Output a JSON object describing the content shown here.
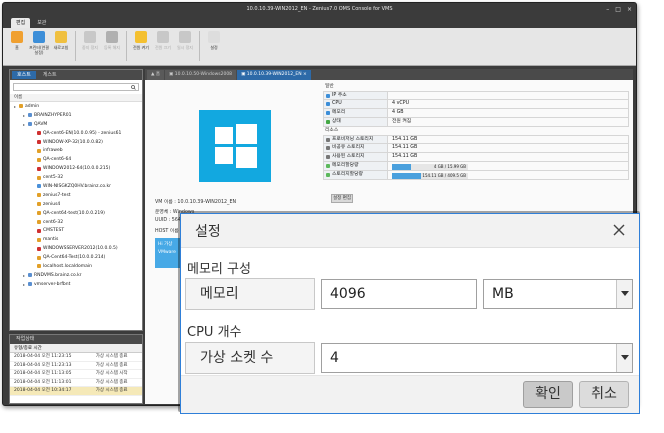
{
  "window": {
    "title": "10.0.10.39-WIN2012_EN - Zenius7.0 OMS Console for VMS",
    "controls": [
      "–",
      "□",
      "×"
    ]
  },
  "menu": {
    "tabs": [
      "편집",
      "보관"
    ]
  },
  "ribbon": {
    "buttons": [
      {
        "label": "홈",
        "icon": "home-icon",
        "color": "#f0a030",
        "disabled": false
      },
      {
        "label": "프린터(연결 설정)",
        "icon": "printer-icon",
        "color": "#3c8ed8",
        "disabled": false
      },
      {
        "label": "새로고침",
        "icon": "refresh-icon",
        "color": "#f0c040",
        "disabled": false
      },
      {
        "label": "중지 정지",
        "icon": "stop-icon",
        "color": "#c8c8c8",
        "disabled": true
      },
      {
        "label": "등록 해지",
        "icon": "register-icon",
        "color": "#b0b0b0",
        "disabled": true
      },
      {
        "label": "전원 켜기",
        "icon": "power-on-icon",
        "color": "#f4c030",
        "disabled": false
      },
      {
        "label": "전원 끄기",
        "icon": "power-off-icon",
        "color": "#c8c8c8",
        "disabled": true
      },
      {
        "label": "일시 정지",
        "icon": "pause-icon",
        "color": "#c8c8c8",
        "disabled": true
      },
      {
        "label": "설정",
        "icon": "settings-icon",
        "color": "#dddddd",
        "disabled": false
      }
    ]
  },
  "left": {
    "tabs": [
      "호스트",
      "게스트"
    ],
    "search_icon": "search-icon",
    "tree_header": "이름",
    "tree": [
      {
        "text": "admin",
        "indent": 0,
        "color": "#e2a028"
      },
      {
        "text": "BRAINZHYPER01",
        "indent": 1,
        "color": "#5a8fd0"
      },
      {
        "text": "QAVM",
        "indent": 1,
        "color": "#5a8fd0"
      },
      {
        "text": "QA-cent6-EN(10.0.0.95) - zenius61",
        "indent": 2,
        "color": "#d03030"
      },
      {
        "text": "WINDOW-XP-32(10.0.0.82)",
        "indent": 2,
        "color": "#d03030"
      },
      {
        "text": "infraweb",
        "indent": 2,
        "color": "#e2a028"
      },
      {
        "text": "QA-cent6-64",
        "indent": 2,
        "color": "#e2a028"
      },
      {
        "text": "WINDOW2012-64(10.0.0.215)",
        "indent": 2,
        "color": "#d03030"
      },
      {
        "text": "cent5-32",
        "indent": 2,
        "color": "#e2a028"
      },
      {
        "text": "WIN-NISGKZQ0HV.brainz.co.kr",
        "indent": 2,
        "color": "#4a90d9"
      },
      {
        "text": "zenius7-test",
        "indent": 2,
        "color": "#e2a028"
      },
      {
        "text": "zenius4",
        "indent": 2,
        "color": "#e2a028"
      },
      {
        "text": "QA-cent64-test(10.0.0.219)",
        "indent": 2,
        "color": "#e2a028"
      },
      {
        "text": "cent6-32",
        "indent": 2,
        "color": "#e2a028"
      },
      {
        "text": "CMSTEST",
        "indent": 2,
        "color": "#d03030"
      },
      {
        "text": "mantis",
        "indent": 2,
        "color": "#e2a028"
      },
      {
        "text": "WINDOWSSERVER2012(10.0.0.5)",
        "indent": 2,
        "color": "#d03030"
      },
      {
        "text": "QA-Cent64-Test(10.0.0.214)",
        "indent": 2,
        "color": "#e2a028"
      },
      {
        "text": "localhost.localdomain",
        "indent": 2,
        "color": "#e2a028"
      },
      {
        "text": "RNDVMS.brainz.co.kr",
        "indent": 1,
        "color": "#5a8fd0"
      },
      {
        "text": "vmserver-brfbnt",
        "indent": 1,
        "color": "#5a8fd0"
      }
    ]
  },
  "log": {
    "tab": "작업상태",
    "columns": [
      "유형/종료 시간",
      ""
    ],
    "rows": [
      {
        "time": "2018-04-04 오전 11:23:15",
        "msg": "가상 시스템 종료"
      },
      {
        "time": "2018-04-04 오전 11:23:13",
        "msg": "가상 시스템 종료"
      },
      {
        "time": "2018-04-04 오전 11:13:05",
        "msg": "가상 시스템 시작"
      },
      {
        "time": "2018-04-04 오전 11:13:01",
        "msg": "가상 시스템 종료"
      },
      {
        "time": "2018-04-04 오전 10:34:17",
        "msg": "가상 시스템 종료"
      }
    ]
  },
  "main": {
    "tabs": [
      "홈",
      "10.0.10.50-Windows2008",
      "10.0.10.39-WIN2012_EN"
    ],
    "vm_info": [
      "VM 이름 : 10.0.10.39-WIN2012_EN",
      "운영체 : Windows",
      "UUID : 564",
      "HOST 이름"
    ],
    "blue_box_lines": [
      "Hi 가상",
      "VMware"
    ],
    "general_section": "일반",
    "general": [
      {
        "key": "IP 주소",
        "value": "",
        "icon_color": "#3c8ed8"
      },
      {
        "key": "CPU",
        "value": "4 vCPU",
        "icon_color": "#3c8ed8"
      },
      {
        "key": "메모리",
        "value": "4 GB",
        "icon_color": "#3c8ed8"
      },
      {
        "key": "상태",
        "value": "전원 켜짐",
        "icon_color": "#44a844"
      }
    ],
    "resource_section": "리소스",
    "resources": [
      {
        "key": "프로비저닝 스토리지",
        "value": "154.11 GB"
      },
      {
        "key": "비공유 스토리지",
        "value": "154.11 GB"
      },
      {
        "key": "사용된 스토리지",
        "value": "154.11 GB"
      },
      {
        "key": "메모리할당량",
        "value": "4 GB / 15.99 GB",
        "fill": 0.25
      },
      {
        "key": "스토리지할당량",
        "value": "154.11 GB / 409.5 GB",
        "fill": 0.38
      }
    ],
    "edit_button": "설정 편집"
  },
  "dialog": {
    "title": "설정",
    "memory_section": "메모리 구성",
    "memory_label": "메모리",
    "memory_value": "4096",
    "memory_unit": "MB",
    "cpu_section": "CPU 개수",
    "socket_label": "가상 소켓 수",
    "socket_value": "4",
    "ok": "확인",
    "cancel": "취소"
  }
}
